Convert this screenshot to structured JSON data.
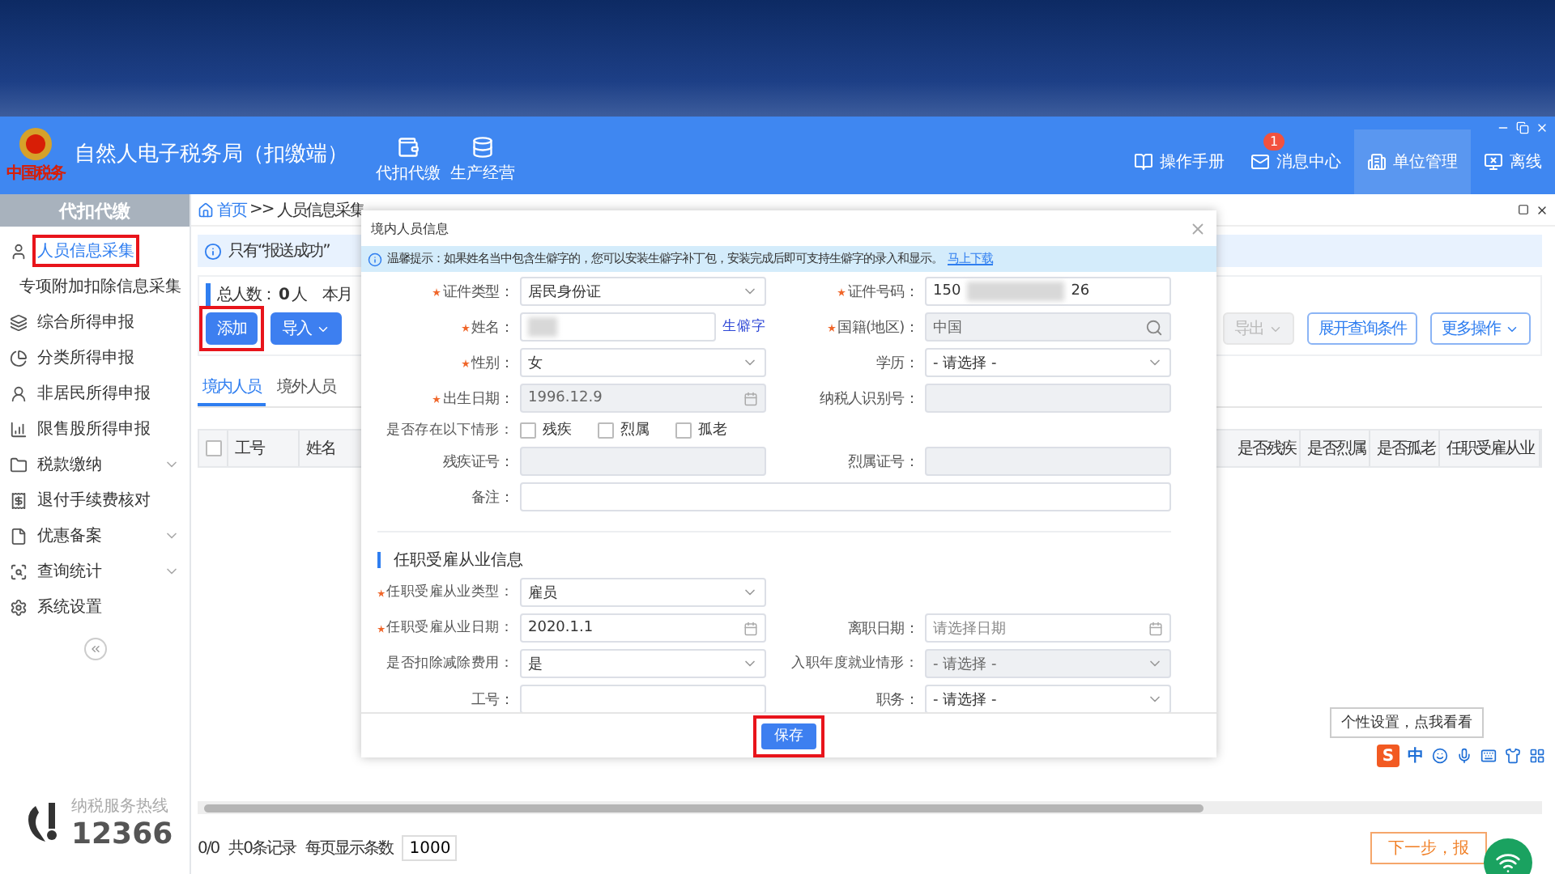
{
  "app": {
    "logo_text": "中国税务",
    "title": "自然人电子税务局（扣缴端）",
    "nav": [
      {
        "label": "代扣代缴"
      },
      {
        "label": "生产经营"
      }
    ],
    "actions": [
      {
        "label": "操作手册",
        "selected": false
      },
      {
        "label": "消息中心",
        "badge": "1",
        "selected": false
      },
      {
        "label": "单位管理",
        "selected": true
      },
      {
        "label": "离线",
        "selected": false
      }
    ]
  },
  "sidebar": {
    "title": "代扣代缴",
    "items": [
      {
        "label": "人员信息采集",
        "selected": true,
        "highlighted": true,
        "expandable": false
      },
      {
        "label": "专项附加扣除信息采集",
        "selected": false,
        "highlighted": false,
        "expandable": false
      },
      {
        "label": "综合所得申报",
        "selected": false,
        "highlighted": false,
        "expandable": false
      },
      {
        "label": "分类所得申报",
        "selected": false,
        "highlighted": false,
        "expandable": false
      },
      {
        "label": "非居民所得申报",
        "selected": false,
        "highlighted": false,
        "expandable": false
      },
      {
        "label": "限售股所得申报",
        "selected": false,
        "highlighted": false,
        "expandable": false
      },
      {
        "label": "税款缴纳",
        "selected": false,
        "highlighted": false,
        "expandable": true
      },
      {
        "label": "退付手续费核对",
        "selected": false,
        "highlighted": false,
        "expandable": false
      },
      {
        "label": "优惠备案",
        "selected": false,
        "highlighted": false,
        "expandable": true
      },
      {
        "label": "查询统计",
        "selected": false,
        "highlighted": false,
        "expandable": true
      },
      {
        "label": "系统设置",
        "selected": false,
        "highlighted": false,
        "expandable": false
      }
    ],
    "hotline": {
      "label": "纳税服务热线",
      "number": "12366"
    }
  },
  "breadcrumb": {
    "home": "首页",
    "separator": ">>",
    "current": "人员信息采集"
  },
  "notice": "只有“报送成功”",
  "summary": {
    "label": "总人数：",
    "count": "0",
    "unit": "人",
    "extra": "本月"
  },
  "toolbar": [
    {
      "label": "添加",
      "kind": "primary",
      "highlighted": true,
      "disabled": false
    },
    {
      "label": "导入",
      "kind": "dropdown",
      "highlighted": false,
      "disabled": false
    },
    {
      "label": "导出",
      "kind": "dropdown",
      "highlighted": false,
      "disabled": true
    },
    {
      "label": "展开查询条件",
      "kind": "outline",
      "highlighted": false,
      "disabled": false
    },
    {
      "label": "更多操作",
      "kind": "outline-dropdown",
      "highlighted": false,
      "disabled": false
    }
  ],
  "tabs": [
    {
      "label": "境内人员",
      "selected": true
    },
    {
      "label": "境外人员",
      "selected": false
    }
  ],
  "table": {
    "select_all": {
      "checked": false
    },
    "columns_left": [
      "工号",
      "姓名"
    ],
    "columns_right": [
      "是否残疾",
      "是否烈属",
      "是否孤老",
      "任职受雇从业"
    ]
  },
  "pagination": {
    "pages": "0/0",
    "total": "共0条记录",
    "per_page_label": "每页显示条数",
    "per_page": "1000",
    "next": "下一步，报"
  },
  "modal": {
    "title": "境内人员信息",
    "tip": "温馨提示：如果姓名当中包含生僻字的，您可以安装生僻字补丁包，安装完成后即可支持生僻字的录入和显示。",
    "tip_link": "马上下载",
    "sections": [
      {
        "rows": [
          [
            {
              "label": "证件类型：",
              "required": true,
              "kind": "select",
              "value": "居民身份证",
              "disabled": false
            },
            {
              "label": "证件号码：",
              "required": true,
              "kind": "text",
              "value": "150",
              "masked": true,
              "value_tail": "26",
              "disabled": false
            }
          ],
          [
            {
              "label": "姓名：",
              "required": true,
              "kind": "text",
              "masked": true,
              "link": "生僻字",
              "disabled": false
            },
            {
              "label": "国籍(地区)：",
              "required": true,
              "kind": "search",
              "value": "中国",
              "disabled": true
            }
          ],
          [
            {
              "label": "性别：",
              "required": true,
              "kind": "select",
              "value": "女",
              "disabled": false
            },
            {
              "label": "学历：",
              "required": false,
              "kind": "select",
              "value": "- 请选择 -",
              "disabled": false
            }
          ],
          [
            {
              "label": "出生日期：",
              "required": true,
              "kind": "date",
              "value": "1996.12.9",
              "disabled": true
            },
            {
              "label": "纳税人识别号：",
              "required": false,
              "kind": "text",
              "disabled": true
            }
          ],
          [
            {
              "label": "是否存在以下情形：",
              "required": false,
              "kind": "checkboxes",
              "options": [
                {
                  "label": "残疾",
                  "checked": false
                },
                {
                  "label": "烈属",
                  "checked": false
                },
                {
                  "label": "孤老",
                  "checked": false
                }
              ]
            }
          ],
          [
            {
              "label": "残疾证号：",
              "required": false,
              "kind": "text",
              "disabled": true
            },
            {
              "label": "烈属证号：",
              "required": false,
              "kind": "text",
              "disabled": true
            }
          ],
          [
            {
              "label": "备注：",
              "required": false,
              "kind": "note",
              "disabled": false
            }
          ]
        ]
      },
      {
        "title": "任职受雇从业信息",
        "rows": [
          [
            {
              "label": "任职受雇从业类型：",
              "required": true,
              "kind": "select",
              "value": "雇员",
              "disabled": false
            }
          ],
          [
            {
              "label": "任职受雇从业日期：",
              "required": true,
              "kind": "date",
              "value": "2020.1.1",
              "disabled": false
            },
            {
              "label": "离职日期：",
              "required": false,
              "kind": "date",
              "placeholder": "请选择日期",
              "disabled": false
            }
          ],
          [
            {
              "label": "是否扣除减除费用：",
              "required": false,
              "kind": "select",
              "value": "是",
              "disabled": false
            },
            {
              "label": "入职年度就业情形：",
              "required": false,
              "kind": "select",
              "value": "- 请选择 -",
              "disabled": true
            }
          ],
          [
            {
              "label": "工号：",
              "required": false,
              "kind": "text",
              "disabled": false
            },
            {
              "label": "职务：",
              "required": false,
              "kind": "select",
              "value": "- 请选择 -",
              "disabled": false
            }
          ]
        ]
      }
    ],
    "save": {
      "label": "保存",
      "highlighted": true
    }
  },
  "ime": {
    "tooltip": "个性设置，点我看看",
    "logo_text": "S",
    "mode": "中"
  }
}
